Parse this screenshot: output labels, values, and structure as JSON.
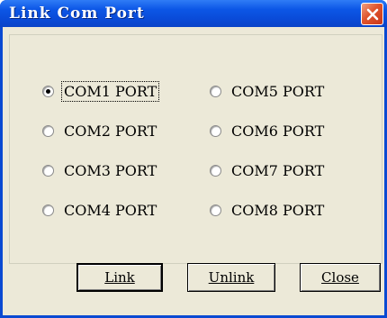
{
  "window": {
    "title": "Link Com Port"
  },
  "ports": [
    {
      "label": "COM1 PORT",
      "checked": true
    },
    {
      "label": "COM2 PORT",
      "checked": false
    },
    {
      "label": "COM3 PORT",
      "checked": false
    },
    {
      "label": "COM4 PORT",
      "checked": false
    },
    {
      "label": "COM5 PORT",
      "checked": false
    },
    {
      "label": "COM6 PORT",
      "checked": false
    },
    {
      "label": "COM7 PORT",
      "checked": false
    },
    {
      "label": "COM8 PORT",
      "checked": false
    }
  ],
  "buttons": {
    "link": "Link",
    "unlink": "Unlink",
    "close": "Close"
  },
  "colors": {
    "titlebar": "#0c56e6",
    "client": "#ece9d8",
    "close_button": "#e0542c"
  }
}
